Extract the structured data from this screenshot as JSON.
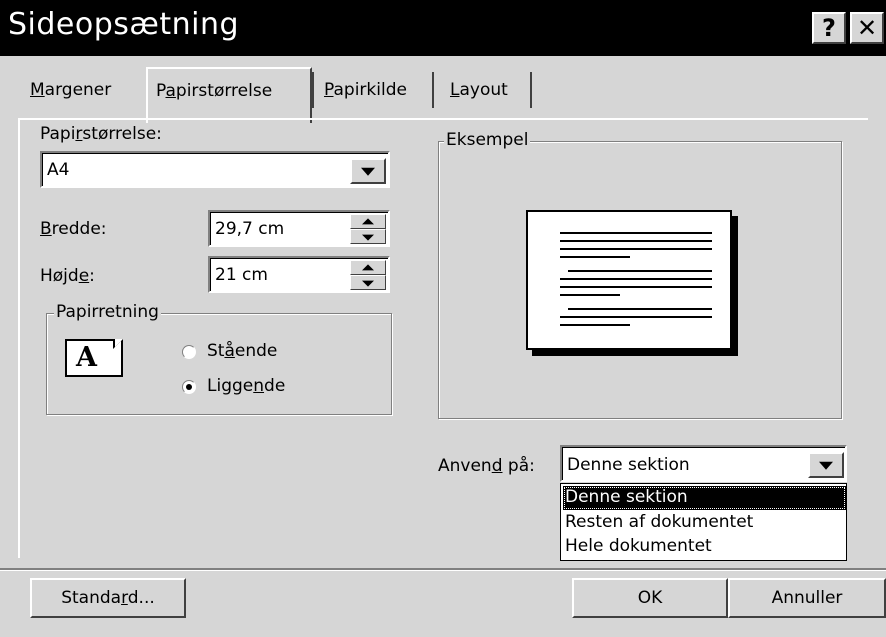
{
  "window": {
    "title": "Sideopsætning",
    "help": "?",
    "close": "✕"
  },
  "tabs": [
    {
      "label": "Margener",
      "key": "M",
      "rest": "argener"
    },
    {
      "label": "Papirstørrelse",
      "pre": "P",
      "key": "a",
      "rest": "pirstørrelse",
      "active": true
    },
    {
      "label": "Papirkilde",
      "key": "P",
      "rest": "apirkilde"
    },
    {
      "label": "Layout",
      "key": "L",
      "rest": "ayout"
    }
  ],
  "paper_size": {
    "pre": "Papi",
    "key": "r",
    "rest": "størrelse:",
    "value": "A4"
  },
  "width": {
    "key": "B",
    "rest": "redde:",
    "value": "29,7 cm"
  },
  "height": {
    "pre": "Højd",
    "key": "e",
    "rest": ":",
    "value": "21 cm"
  },
  "orientation": {
    "title": "Papirretning",
    "icon_letter": "A",
    "portrait": {
      "pre": "St",
      "key": "å",
      "rest": "ende",
      "selected": false
    },
    "landscape": {
      "pre": "Ligge",
      "key": "n",
      "rest": "de",
      "selected": true
    }
  },
  "preview": {
    "title": "Eksempel"
  },
  "apply_to": {
    "pre": "Anven",
    "key": "d",
    "rest": " på:",
    "value": "Denne sektion",
    "options": [
      "Denne sektion",
      "Resten af dokumentet",
      "Hele dokumentet"
    ],
    "highlighted_index": 0
  },
  "buttons": {
    "standard": {
      "pre": "Standa",
      "key": "r",
      "rest": "d..."
    },
    "ok": "OK",
    "cancel": "Annuller"
  },
  "colors": {
    "face": "#d6d6d6",
    "title_bar": "#000000",
    "highlight": "#000000"
  }
}
